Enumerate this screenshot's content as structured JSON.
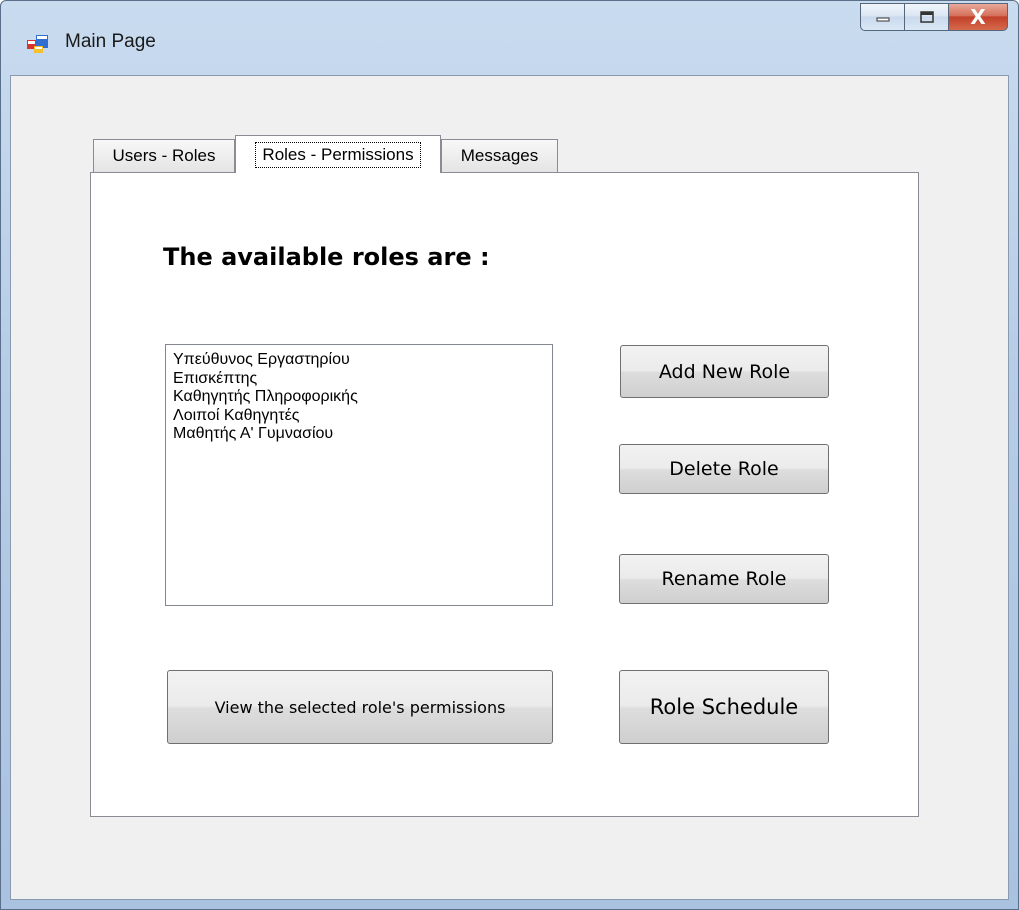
{
  "window": {
    "title": "Main Page",
    "icon": "app-window-icon",
    "controls": {
      "minimize_icon": "minimize-icon",
      "maximize_icon": "maximize-icon",
      "close_label": "X"
    }
  },
  "tabs": [
    {
      "label": "Users - Roles",
      "selected": false
    },
    {
      "label": "Roles - Permissions",
      "selected": true
    },
    {
      "label": "Messages",
      "selected": false
    }
  ],
  "roles_page": {
    "heading": "The available roles are :",
    "roles": [
      "Υπεύθυνος Εργαστηρίου",
      "Επισκέπτης",
      "Καθηγητής Πληροφορικής",
      "Λοιποί Καθηγητές",
      "Μαθητής Α' Γυμνασίου"
    ],
    "buttons": {
      "add": "Add New Role",
      "delete": "Delete Role",
      "rename": "Rename Role",
      "view_permissions": "View the selected role's permissions",
      "schedule": "Role Schedule"
    }
  },
  "colors": {
    "client_bg": "#f0f0f0",
    "tabpage_bg": "#ffffff",
    "close_button": "#c1402a"
  }
}
